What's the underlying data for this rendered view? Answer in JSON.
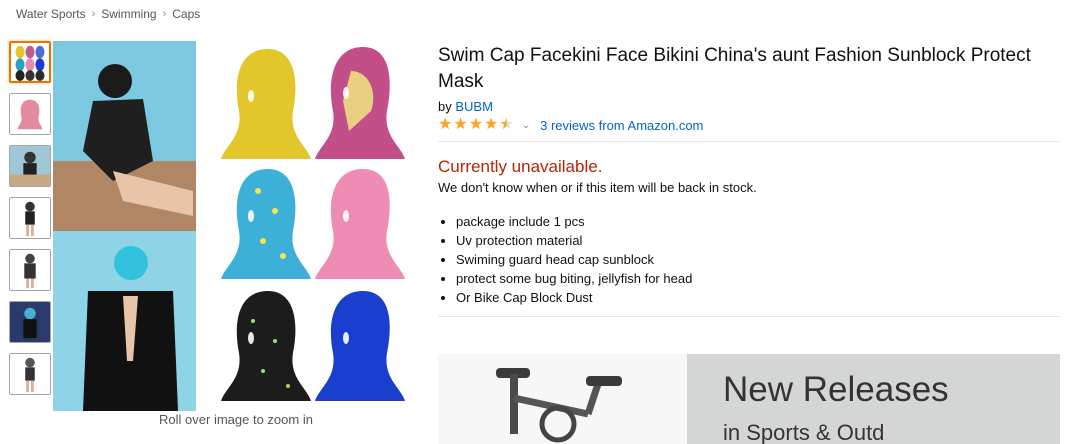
{
  "breadcrumb": {
    "items": [
      "Water Sports",
      "Swimming",
      "Caps"
    ],
    "separator": "›"
  },
  "gallery": {
    "thumbnail_count": 7,
    "selected_index": 0,
    "zoom_hint": "Roll over image to zoom in"
  },
  "product": {
    "title": "Swim Cap Facekini Face Bikini China's aunt Fashion Sunblock Protect Mask",
    "by_prefix": "by",
    "brand": "BUBM",
    "rating": 4.5,
    "rating_chevron": "⌄",
    "reviews_link": "3 reviews from Amazon.com",
    "availability": "Currently unavailable.",
    "availability_note": "We don't know when or if this item will be back in stock.",
    "bullets": [
      "package include 1 pcs",
      "Uv protection material",
      "Swiming guard head cap sunblock",
      "protect some bug biting, jellyfish for head",
      "Or Bike Cap Block Dust"
    ]
  },
  "ad": {
    "headline": "New Releases",
    "subline": "in Sports & Outd"
  },
  "colors": {
    "link": "#0066c0",
    "unavailable": "#b12704",
    "star": "#ffa41c",
    "thumb_selected": "#e77600"
  },
  "icons": {
    "star": "star-icon",
    "chevron": "chevron-down-icon"
  }
}
